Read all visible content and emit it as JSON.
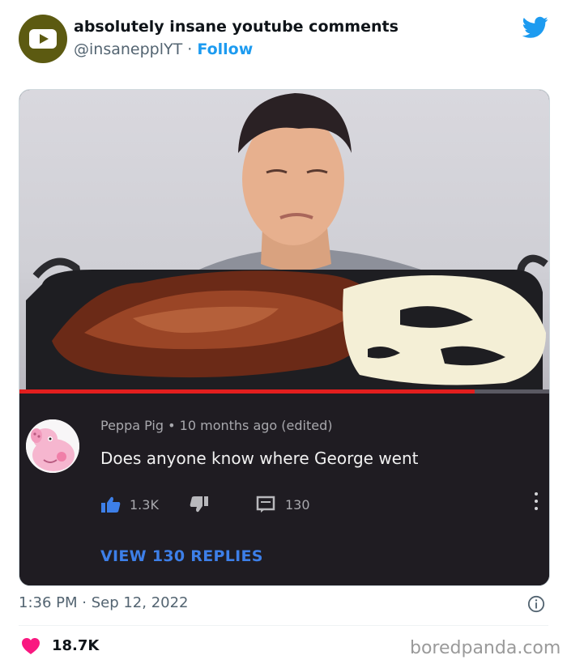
{
  "tweet": {
    "display_name": "absolutely insane youtube comments",
    "handle": "@insanepplYT",
    "separator": "·",
    "follow_label": "Follow",
    "timestamp": "1:36 PM · Sep 12, 2022",
    "likes": "18.7K",
    "brand_color": "#1d9bf0",
    "like_color": "#f91880",
    "avatar_icon": "youtube-play-icon",
    "platform_icon": "twitter-bird-icon"
  },
  "youtube_comment": {
    "author": "Peppa Pig",
    "meta_separator": "•",
    "posted": "10 months ago (edited)",
    "text": "Does anyone know where George went",
    "likes": "1.3K",
    "reply_count": "130",
    "view_replies_label": "VIEW 130 REPLIES",
    "progress_fraction": 0.86,
    "progress_color": "#e21e1e"
  },
  "watermark": "boredpanda.com"
}
